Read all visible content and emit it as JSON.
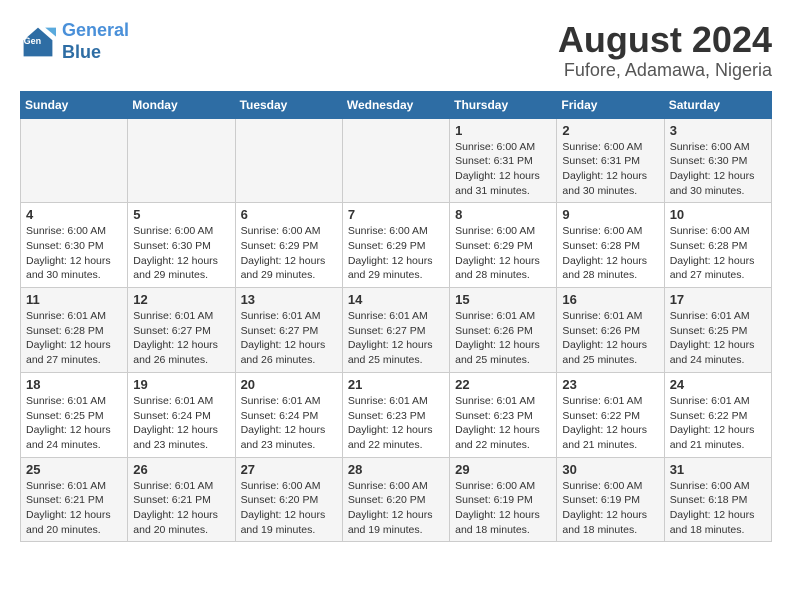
{
  "header": {
    "logo_line1": "General",
    "logo_line2": "Blue",
    "title": "August 2024",
    "subtitle": "Fufore, Adamawa, Nigeria"
  },
  "calendar": {
    "weekdays": [
      "Sunday",
      "Monday",
      "Tuesday",
      "Wednesday",
      "Thursday",
      "Friday",
      "Saturday"
    ],
    "weeks": [
      [
        {
          "day": "",
          "info": ""
        },
        {
          "day": "",
          "info": ""
        },
        {
          "day": "",
          "info": ""
        },
        {
          "day": "",
          "info": ""
        },
        {
          "day": "1",
          "info": "Sunrise: 6:00 AM\nSunset: 6:31 PM\nDaylight: 12 hours\nand 31 minutes."
        },
        {
          "day": "2",
          "info": "Sunrise: 6:00 AM\nSunset: 6:31 PM\nDaylight: 12 hours\nand 30 minutes."
        },
        {
          "day": "3",
          "info": "Sunrise: 6:00 AM\nSunset: 6:30 PM\nDaylight: 12 hours\nand 30 minutes."
        }
      ],
      [
        {
          "day": "4",
          "info": "Sunrise: 6:00 AM\nSunset: 6:30 PM\nDaylight: 12 hours\nand 30 minutes."
        },
        {
          "day": "5",
          "info": "Sunrise: 6:00 AM\nSunset: 6:30 PM\nDaylight: 12 hours\nand 29 minutes."
        },
        {
          "day": "6",
          "info": "Sunrise: 6:00 AM\nSunset: 6:29 PM\nDaylight: 12 hours\nand 29 minutes."
        },
        {
          "day": "7",
          "info": "Sunrise: 6:00 AM\nSunset: 6:29 PM\nDaylight: 12 hours\nand 29 minutes."
        },
        {
          "day": "8",
          "info": "Sunrise: 6:00 AM\nSunset: 6:29 PM\nDaylight: 12 hours\nand 28 minutes."
        },
        {
          "day": "9",
          "info": "Sunrise: 6:00 AM\nSunset: 6:28 PM\nDaylight: 12 hours\nand 28 minutes."
        },
        {
          "day": "10",
          "info": "Sunrise: 6:00 AM\nSunset: 6:28 PM\nDaylight: 12 hours\nand 27 minutes."
        }
      ],
      [
        {
          "day": "11",
          "info": "Sunrise: 6:01 AM\nSunset: 6:28 PM\nDaylight: 12 hours\nand 27 minutes."
        },
        {
          "day": "12",
          "info": "Sunrise: 6:01 AM\nSunset: 6:27 PM\nDaylight: 12 hours\nand 26 minutes."
        },
        {
          "day": "13",
          "info": "Sunrise: 6:01 AM\nSunset: 6:27 PM\nDaylight: 12 hours\nand 26 minutes."
        },
        {
          "day": "14",
          "info": "Sunrise: 6:01 AM\nSunset: 6:27 PM\nDaylight: 12 hours\nand 25 minutes."
        },
        {
          "day": "15",
          "info": "Sunrise: 6:01 AM\nSunset: 6:26 PM\nDaylight: 12 hours\nand 25 minutes."
        },
        {
          "day": "16",
          "info": "Sunrise: 6:01 AM\nSunset: 6:26 PM\nDaylight: 12 hours\nand 25 minutes."
        },
        {
          "day": "17",
          "info": "Sunrise: 6:01 AM\nSunset: 6:25 PM\nDaylight: 12 hours\nand 24 minutes."
        }
      ],
      [
        {
          "day": "18",
          "info": "Sunrise: 6:01 AM\nSunset: 6:25 PM\nDaylight: 12 hours\nand 24 minutes."
        },
        {
          "day": "19",
          "info": "Sunrise: 6:01 AM\nSunset: 6:24 PM\nDaylight: 12 hours\nand 23 minutes."
        },
        {
          "day": "20",
          "info": "Sunrise: 6:01 AM\nSunset: 6:24 PM\nDaylight: 12 hours\nand 23 minutes."
        },
        {
          "day": "21",
          "info": "Sunrise: 6:01 AM\nSunset: 6:23 PM\nDaylight: 12 hours\nand 22 minutes."
        },
        {
          "day": "22",
          "info": "Sunrise: 6:01 AM\nSunset: 6:23 PM\nDaylight: 12 hours\nand 22 minutes."
        },
        {
          "day": "23",
          "info": "Sunrise: 6:01 AM\nSunset: 6:22 PM\nDaylight: 12 hours\nand 21 minutes."
        },
        {
          "day": "24",
          "info": "Sunrise: 6:01 AM\nSunset: 6:22 PM\nDaylight: 12 hours\nand 21 minutes."
        }
      ],
      [
        {
          "day": "25",
          "info": "Sunrise: 6:01 AM\nSunset: 6:21 PM\nDaylight: 12 hours\nand 20 minutes."
        },
        {
          "day": "26",
          "info": "Sunrise: 6:01 AM\nSunset: 6:21 PM\nDaylight: 12 hours\nand 20 minutes."
        },
        {
          "day": "27",
          "info": "Sunrise: 6:00 AM\nSunset: 6:20 PM\nDaylight: 12 hours\nand 19 minutes."
        },
        {
          "day": "28",
          "info": "Sunrise: 6:00 AM\nSunset: 6:20 PM\nDaylight: 12 hours\nand 19 minutes."
        },
        {
          "day": "29",
          "info": "Sunrise: 6:00 AM\nSunset: 6:19 PM\nDaylight: 12 hours\nand 18 minutes."
        },
        {
          "day": "30",
          "info": "Sunrise: 6:00 AM\nSunset: 6:19 PM\nDaylight: 12 hours\nand 18 minutes."
        },
        {
          "day": "31",
          "info": "Sunrise: 6:00 AM\nSunset: 6:18 PM\nDaylight: 12 hours\nand 18 minutes."
        }
      ]
    ]
  }
}
